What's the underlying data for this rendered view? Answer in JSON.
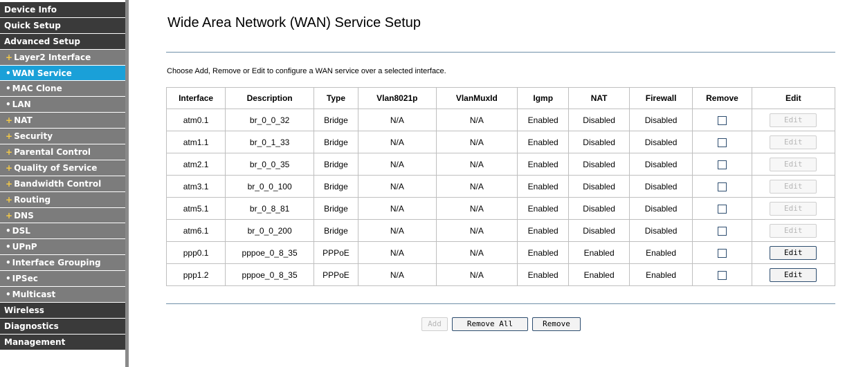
{
  "sidebar": {
    "items": [
      {
        "label": "Device Info",
        "bullet": ""
      },
      {
        "label": "Quick Setup",
        "bullet": ""
      },
      {
        "label": "Advanced Setup",
        "bullet": ""
      },
      {
        "label": "Layer2 Interface",
        "bullet": "+"
      },
      {
        "label": "WAN Service",
        "bullet": "•"
      },
      {
        "label": "MAC Clone",
        "bullet": "•"
      },
      {
        "label": "LAN",
        "bullet": "•"
      },
      {
        "label": "NAT",
        "bullet": "+"
      },
      {
        "label": "Security",
        "bullet": "+"
      },
      {
        "label": "Parental Control",
        "bullet": "+"
      },
      {
        "label": "Quality of Service",
        "bullet": "+"
      },
      {
        "label": "Bandwidth Control",
        "bullet": "+"
      },
      {
        "label": "Routing",
        "bullet": "+"
      },
      {
        "label": "DNS",
        "bullet": "+"
      },
      {
        "label": "DSL",
        "bullet": "•"
      },
      {
        "label": "UPnP",
        "bullet": "•"
      },
      {
        "label": "Interface Grouping",
        "bullet": "•"
      },
      {
        "label": "IPSec",
        "bullet": "•"
      },
      {
        "label": "Multicast",
        "bullet": "•"
      },
      {
        "label": "Wireless",
        "bullet": ""
      },
      {
        "label": "Diagnostics",
        "bullet": ""
      },
      {
        "label": "Management",
        "bullet": ""
      }
    ]
  },
  "colors": {
    "sidebar_top": "#3a3a3a",
    "sidebar_sub": "#7c7c7c",
    "sidebar_active": "#1aa0d8",
    "plus_bullet": "#f3c948",
    "rule": "#6e8fa8"
  },
  "main": {
    "title": "Wide Area Network (WAN) Service Setup",
    "instructions": "Choose Add, Remove or Edit to configure a WAN service over a selected interface.",
    "table": {
      "headers": [
        "Interface",
        "Description",
        "Type",
        "Vlan8021p",
        "VlanMuxId",
        "Igmp",
        "NAT",
        "Firewall",
        "Remove",
        "Edit"
      ],
      "rows": [
        {
          "interface": "atm0.1",
          "description": "br_0_0_32",
          "type": "Bridge",
          "vlan8021p": "N/A",
          "vlanmuxid": "N/A",
          "igmp": "Enabled",
          "nat": "Disabled",
          "firewall": "Disabled",
          "remove_checked": false,
          "edit_label": "Edit",
          "edit_enabled": false
        },
        {
          "interface": "atm1.1",
          "description": "br_0_1_33",
          "type": "Bridge",
          "vlan8021p": "N/A",
          "vlanmuxid": "N/A",
          "igmp": "Enabled",
          "nat": "Disabled",
          "firewall": "Disabled",
          "remove_checked": false,
          "edit_label": "Edit",
          "edit_enabled": false
        },
        {
          "interface": "atm2.1",
          "description": "br_0_0_35",
          "type": "Bridge",
          "vlan8021p": "N/A",
          "vlanmuxid": "N/A",
          "igmp": "Enabled",
          "nat": "Disabled",
          "firewall": "Disabled",
          "remove_checked": false,
          "edit_label": "Edit",
          "edit_enabled": false
        },
        {
          "interface": "atm3.1",
          "description": "br_0_0_100",
          "type": "Bridge",
          "vlan8021p": "N/A",
          "vlanmuxid": "N/A",
          "igmp": "Enabled",
          "nat": "Disabled",
          "firewall": "Disabled",
          "remove_checked": false,
          "edit_label": "Edit",
          "edit_enabled": false
        },
        {
          "interface": "atm5.1",
          "description": "br_0_8_81",
          "type": "Bridge",
          "vlan8021p": "N/A",
          "vlanmuxid": "N/A",
          "igmp": "Enabled",
          "nat": "Disabled",
          "firewall": "Disabled",
          "remove_checked": false,
          "edit_label": "Edit",
          "edit_enabled": false
        },
        {
          "interface": "atm6.1",
          "description": "br_0_0_200",
          "type": "Bridge",
          "vlan8021p": "N/A",
          "vlanmuxid": "N/A",
          "igmp": "Enabled",
          "nat": "Disabled",
          "firewall": "Disabled",
          "remove_checked": false,
          "edit_label": "Edit",
          "edit_enabled": false
        },
        {
          "interface": "ppp0.1",
          "description": "pppoe_0_8_35",
          "type": "PPPoE",
          "vlan8021p": "N/A",
          "vlanmuxid": "N/A",
          "igmp": "Enabled",
          "nat": "Enabled",
          "firewall": "Enabled",
          "remove_checked": false,
          "edit_label": "Edit",
          "edit_enabled": true
        },
        {
          "interface": "ppp1.2",
          "description": "pppoe_0_8_35",
          "type": "PPPoE",
          "vlan8021p": "N/A",
          "vlanmuxid": "N/A",
          "igmp": "Enabled",
          "nat": "Enabled",
          "firewall": "Enabled",
          "remove_checked": false,
          "edit_label": "Edit",
          "edit_enabled": true
        }
      ]
    },
    "actions": {
      "add_label": "Add",
      "add_enabled": false,
      "remove_all_label": "Remove All",
      "remove_label": "Remove"
    }
  }
}
